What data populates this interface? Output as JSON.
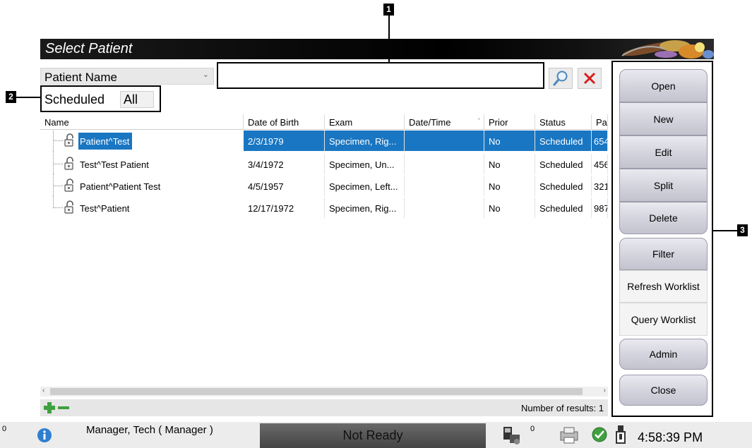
{
  "window": {
    "title": "Select Patient"
  },
  "search": {
    "type_label": "Patient Name",
    "placeholder": "",
    "value": ""
  },
  "tabs": {
    "scheduled": "Scheduled",
    "all": "All"
  },
  "columns": [
    "Name",
    "Date of Birth",
    "Exam",
    "Date/Time",
    "Prior",
    "Status",
    "Pa"
  ],
  "rows": [
    {
      "name": "Patient^Test",
      "dob": "2/3/1979",
      "exam": "Specimen, Rig...",
      "datetime": "",
      "prior": "No",
      "status": "Scheduled",
      "pa": "654",
      "selected": true
    },
    {
      "name": "Test^Test Patient",
      "dob": "3/4/1972",
      "exam": "Specimen, Un...",
      "datetime": "",
      "prior": "No",
      "status": "Scheduled",
      "pa": "456",
      "selected": false
    },
    {
      "name": "Patient^Patient Test",
      "dob": "4/5/1957",
      "exam": "Specimen, Left...",
      "datetime": "",
      "prior": "No",
      "status": "Scheduled",
      "pa": "321",
      "selected": false
    },
    {
      "name": "Test^Patient",
      "dob": "12/17/1972",
      "exam": "Specimen, Rig...",
      "datetime": "",
      "prior": "No",
      "status": "Scheduled",
      "pa": "987",
      "selected": false
    }
  ],
  "footer": {
    "results": "Number of results: 1"
  },
  "side_buttons": {
    "open": "Open",
    "new": "New",
    "edit": "Edit",
    "split": "Split",
    "delete": "Delete",
    "filter": "Filter",
    "refresh": "Refresh Worklist",
    "query": "Query Worklist",
    "admin": "Admin",
    "close": "Close"
  },
  "callouts": {
    "c1": "1",
    "c2": "2",
    "c3": "3"
  },
  "statusbar": {
    "alert_count": "0",
    "user": "Manager, Tech ( Manager )",
    "state": "Not Ready",
    "queue_count": "0",
    "time": "4:58:39 PM"
  },
  "colors": {
    "selection": "#1976c2",
    "accent_red": "#d81e1e",
    "add_green": "#3ea03e"
  },
  "icons": [
    "search-icon",
    "clear-icon",
    "lock-icon",
    "add-icon",
    "remove-icon",
    "info-icon",
    "detector-icon",
    "printer-icon",
    "ok-icon",
    "power-icon"
  ]
}
